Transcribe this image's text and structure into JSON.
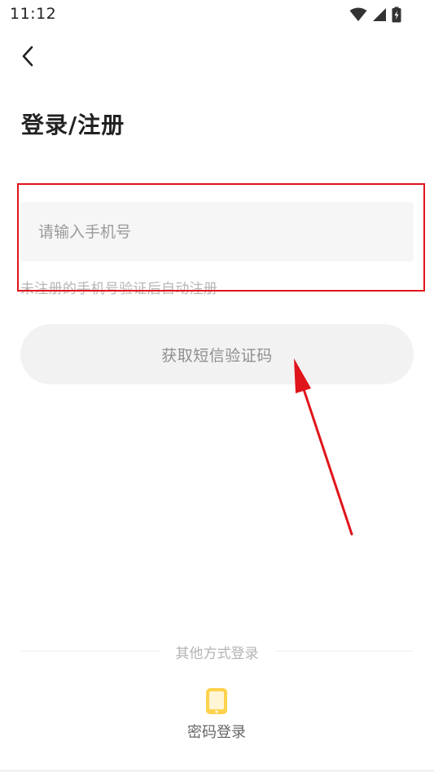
{
  "status_bar": {
    "time": "11:12",
    "icons": [
      "wifi-icon",
      "signal-icon",
      "battery-charging-icon"
    ]
  },
  "nav": {
    "back_icon": "chevron-left-icon"
  },
  "page": {
    "title": "登录/注册"
  },
  "phone_field": {
    "placeholder": "请输入手机号",
    "value": "",
    "hint": "未注册的手机号验证后自动注册"
  },
  "sms_button": {
    "label": "获取短信验证码"
  },
  "other_login": {
    "label": "其他方式登录",
    "password_login": {
      "icon": "phone-icon",
      "label": "密码登录"
    }
  },
  "colors": {
    "annotation_red": "#e0141b",
    "icon_yellow": "#ffd24d",
    "input_bg": "#f6f6f6",
    "button_bg": "#f2f2f2"
  }
}
